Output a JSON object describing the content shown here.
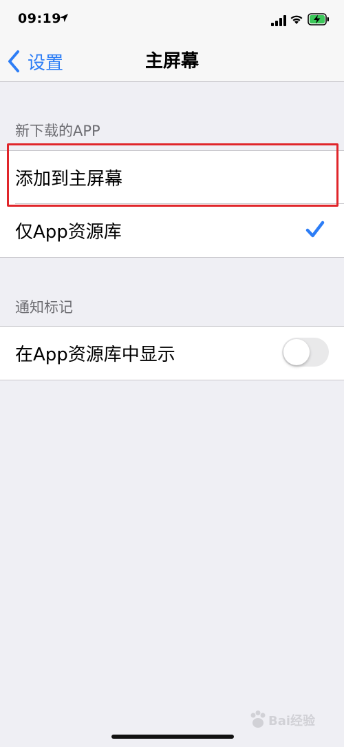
{
  "status_bar": {
    "time": "09:19",
    "icons": [
      "location-arrow-icon",
      "signal-icon",
      "wifi-icon",
      "battery-charging-icon"
    ]
  },
  "nav": {
    "back_label": "设置",
    "title": "主屏幕"
  },
  "sections": [
    {
      "header": "新下载的APP",
      "items": [
        {
          "label": "添加到主屏幕",
          "selected": false,
          "highlighted": true
        },
        {
          "label": "仅App资源库",
          "selected": true
        }
      ]
    },
    {
      "header": "通知标记",
      "items": [
        {
          "label": "在App资源库中显示",
          "toggle": false
        }
      ]
    }
  ],
  "watermark": {
    "text": "Bai经验"
  },
  "colors": {
    "accent": "#2c7df6",
    "highlight": "#e0252a",
    "background": "#efeff4"
  }
}
